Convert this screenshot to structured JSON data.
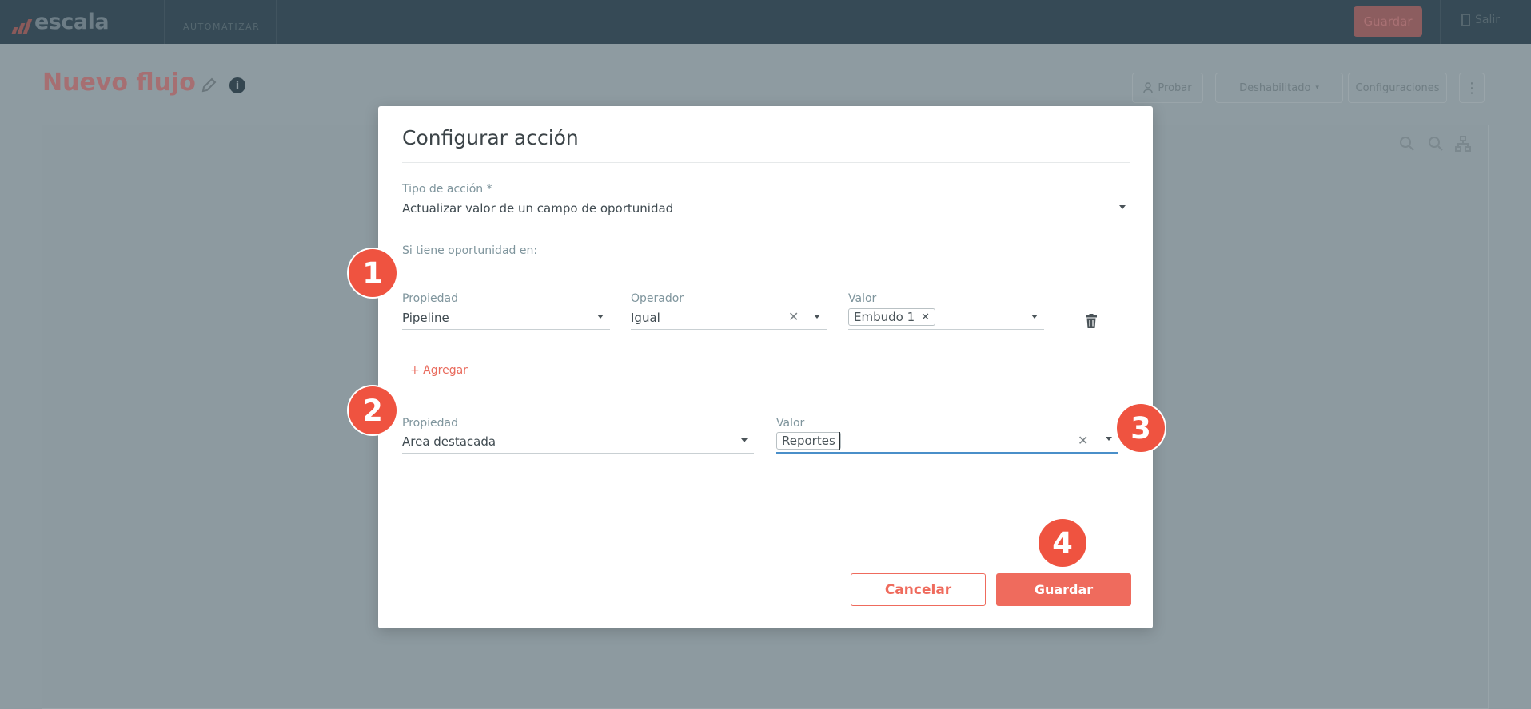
{
  "app": {
    "logo_text": "escala",
    "module": "AUTOMATIZAR",
    "top_save_label": "Guardar",
    "top_exit_label": "Salir"
  },
  "page": {
    "title": "Nuevo flujo",
    "buttons": {
      "test": "Probar",
      "status": "Deshabilitado",
      "settings": "Configuraciones"
    }
  },
  "modal": {
    "title": "Configurar acción",
    "action_type": {
      "label": "Tipo de acción *",
      "value": "Actualizar valor de un campo de oportunidad"
    },
    "condition_section_label": "Si tiene oportunidad en:",
    "condition": {
      "property_label": "Propiedad",
      "property_value": "Pipeline",
      "operator_label": "Operador",
      "operator_value": "Igual",
      "value_label": "Valor",
      "value_chip": "Embudo 1"
    },
    "add_link": "+ Agregar",
    "update": {
      "property_label": "Propiedad",
      "property_value": "Area destacada",
      "value_label": "Valor",
      "value_chip": "Reportes"
    },
    "cancel_label": "Cancelar",
    "save_label": "Guardar"
  },
  "badges": [
    "1",
    "2",
    "3",
    "4"
  ],
  "colors": {
    "accent": "#ef6b5d",
    "badge": "#ef5340",
    "topbar": "#364a56",
    "overlay_bg": "#8e9ba1"
  }
}
